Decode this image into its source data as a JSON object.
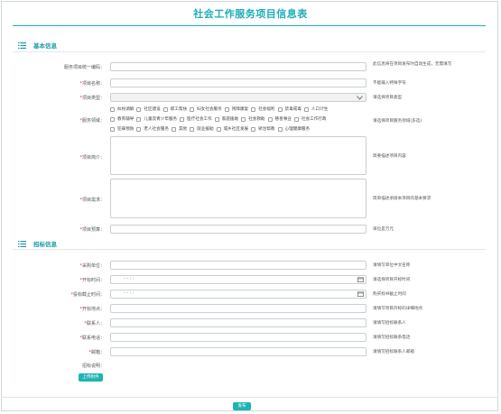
{
  "page": {
    "title": "社会工作服务项目信息表"
  },
  "basic": {
    "heading": "基本信息",
    "code": {
      "label": "服务项目统一编码：",
      "hint": "此信息将在项目发布时自动生成，无需填写"
    },
    "name": {
      "label": "项目名称：",
      "hint": "不能输入特殊字符"
    },
    "type": {
      "label": "项目类型：",
      "value": "",
      "hint": "请选择项目类型"
    },
    "domain": {
      "label": "服务领域：",
      "hint": "请选择项目服务领域(多选)",
      "row1": [
        "社区建设",
        "职工帮扶",
        "妇女社会服务",
        "残障康复",
        "社会福利",
        "禁毒戒毒",
        "人口计生"
      ],
      "row1_first": "纠纷调解",
      "row2": [
        "教育辅导",
        "儿童及青少年服务",
        "医疗社会工作",
        "家庭援助",
        "社会救助",
        "慈善事业",
        "社会工作行政"
      ],
      "row3": [
        "犯罪预防",
        "老人社会服务",
        "其他",
        "就业援助",
        "城乡社区发展",
        "矫治帮教",
        "心理健康服务"
      ]
    },
    "intro": {
      "label": "项目简介：",
      "hint": "简要描述项目内容"
    },
    "needs": {
      "label": "项目需求：",
      "hint": "简单描述承接本项目的基本要求"
    },
    "budget": {
      "label": "项目预算：",
      "hint": "单位是万元"
    }
  },
  "bid": {
    "heading": "招标信息",
    "buyer": {
      "label": "采购单位：",
      "hint": "请填写单位中文名称"
    },
    "start": {
      "label": "开标时间：",
      "value": "- -  :  :",
      "hint": "请选择项目开标时间"
    },
    "deadline": {
      "label": "投标截止时间：",
      "value": "- -  :  :",
      "hint": "购买标书截止时间"
    },
    "place": {
      "label": "开标地点：",
      "hint": "请填写项目开标的详细地点"
    },
    "contact": {
      "label": "联系人：",
      "hint": "请填写招标联系人"
    },
    "phone": {
      "label": "联系电话：",
      "hint": "请填写招标联系电话"
    },
    "email": {
      "label": "邮箱：",
      "hint": "请填写招标联系人邮箱"
    },
    "desc": {
      "label": "招标说明："
    },
    "upload": "上传附件"
  },
  "footer": {
    "publish": "发布"
  },
  "colors": {
    "accent": "#1aaeb5",
    "required": "#e53935"
  }
}
